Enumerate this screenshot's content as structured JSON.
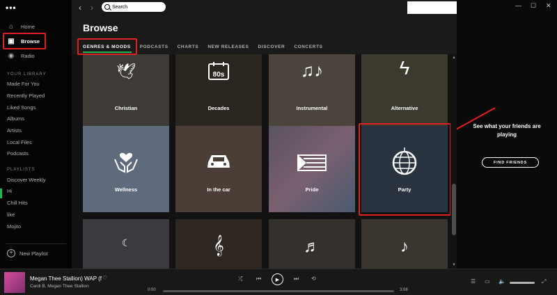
{
  "app": {
    "menu_dots": "•••"
  },
  "sidebar": {
    "nav": [
      {
        "label": "Home",
        "icon": "home-icon"
      },
      {
        "label": "Browse",
        "icon": "browse-icon",
        "active": true
      },
      {
        "label": "Radio",
        "icon": "radio-icon"
      }
    ],
    "library_heading": "YOUR LIBRARY",
    "library": [
      "Made For You",
      "Recently Played",
      "Liked Songs",
      "Albums",
      "Artists",
      "Local Files",
      "Podcasts"
    ],
    "playlists_heading": "PLAYLISTS",
    "playlists": [
      "Discover Weekly",
      "Hi",
      "Chill Hits",
      "like",
      "Mojito"
    ],
    "new_playlist": "New Playlist"
  },
  "topbar": {
    "back": "‹",
    "forward": "›",
    "search_placeholder": "Search"
  },
  "browse": {
    "title": "Browse",
    "tabs": [
      "GENRES & MOODS",
      "PODCASTS",
      "CHARTS",
      "NEW RELEASES",
      "DISCOVER",
      "CONCERTS"
    ],
    "tiles": [
      {
        "label": "Christian",
        "color": "#3e3a35"
      },
      {
        "label": "Decades",
        "color": "#2b2620"
      },
      {
        "label": "Instrumental",
        "color": "#4a443c"
      },
      {
        "label": "Alternative",
        "color": "#3c3a2e"
      },
      {
        "label": "Wellness",
        "color": "#5f6b7d"
      },
      {
        "label": "In the car",
        "color": "#4a3e36"
      },
      {
        "label": "Pride",
        "color": "#5a5260"
      },
      {
        "label": "Party",
        "color": "#2a3440"
      },
      {
        "label": "",
        "color": "#3d3a3f"
      },
      {
        "label": "",
        "color": "#2d2621"
      },
      {
        "label": "",
        "color": "#34302c"
      },
      {
        "label": "",
        "color": "#3b3530"
      }
    ]
  },
  "friends": {
    "text": "See what your friends are playing",
    "button": "FIND FRIENDS"
  },
  "player": {
    "track": "Megan Thee Stallion)   WAP (f",
    "artist": "Cardi B, Megan Thee Stallion",
    "time_current": "0:00",
    "time_total": "3:08"
  }
}
